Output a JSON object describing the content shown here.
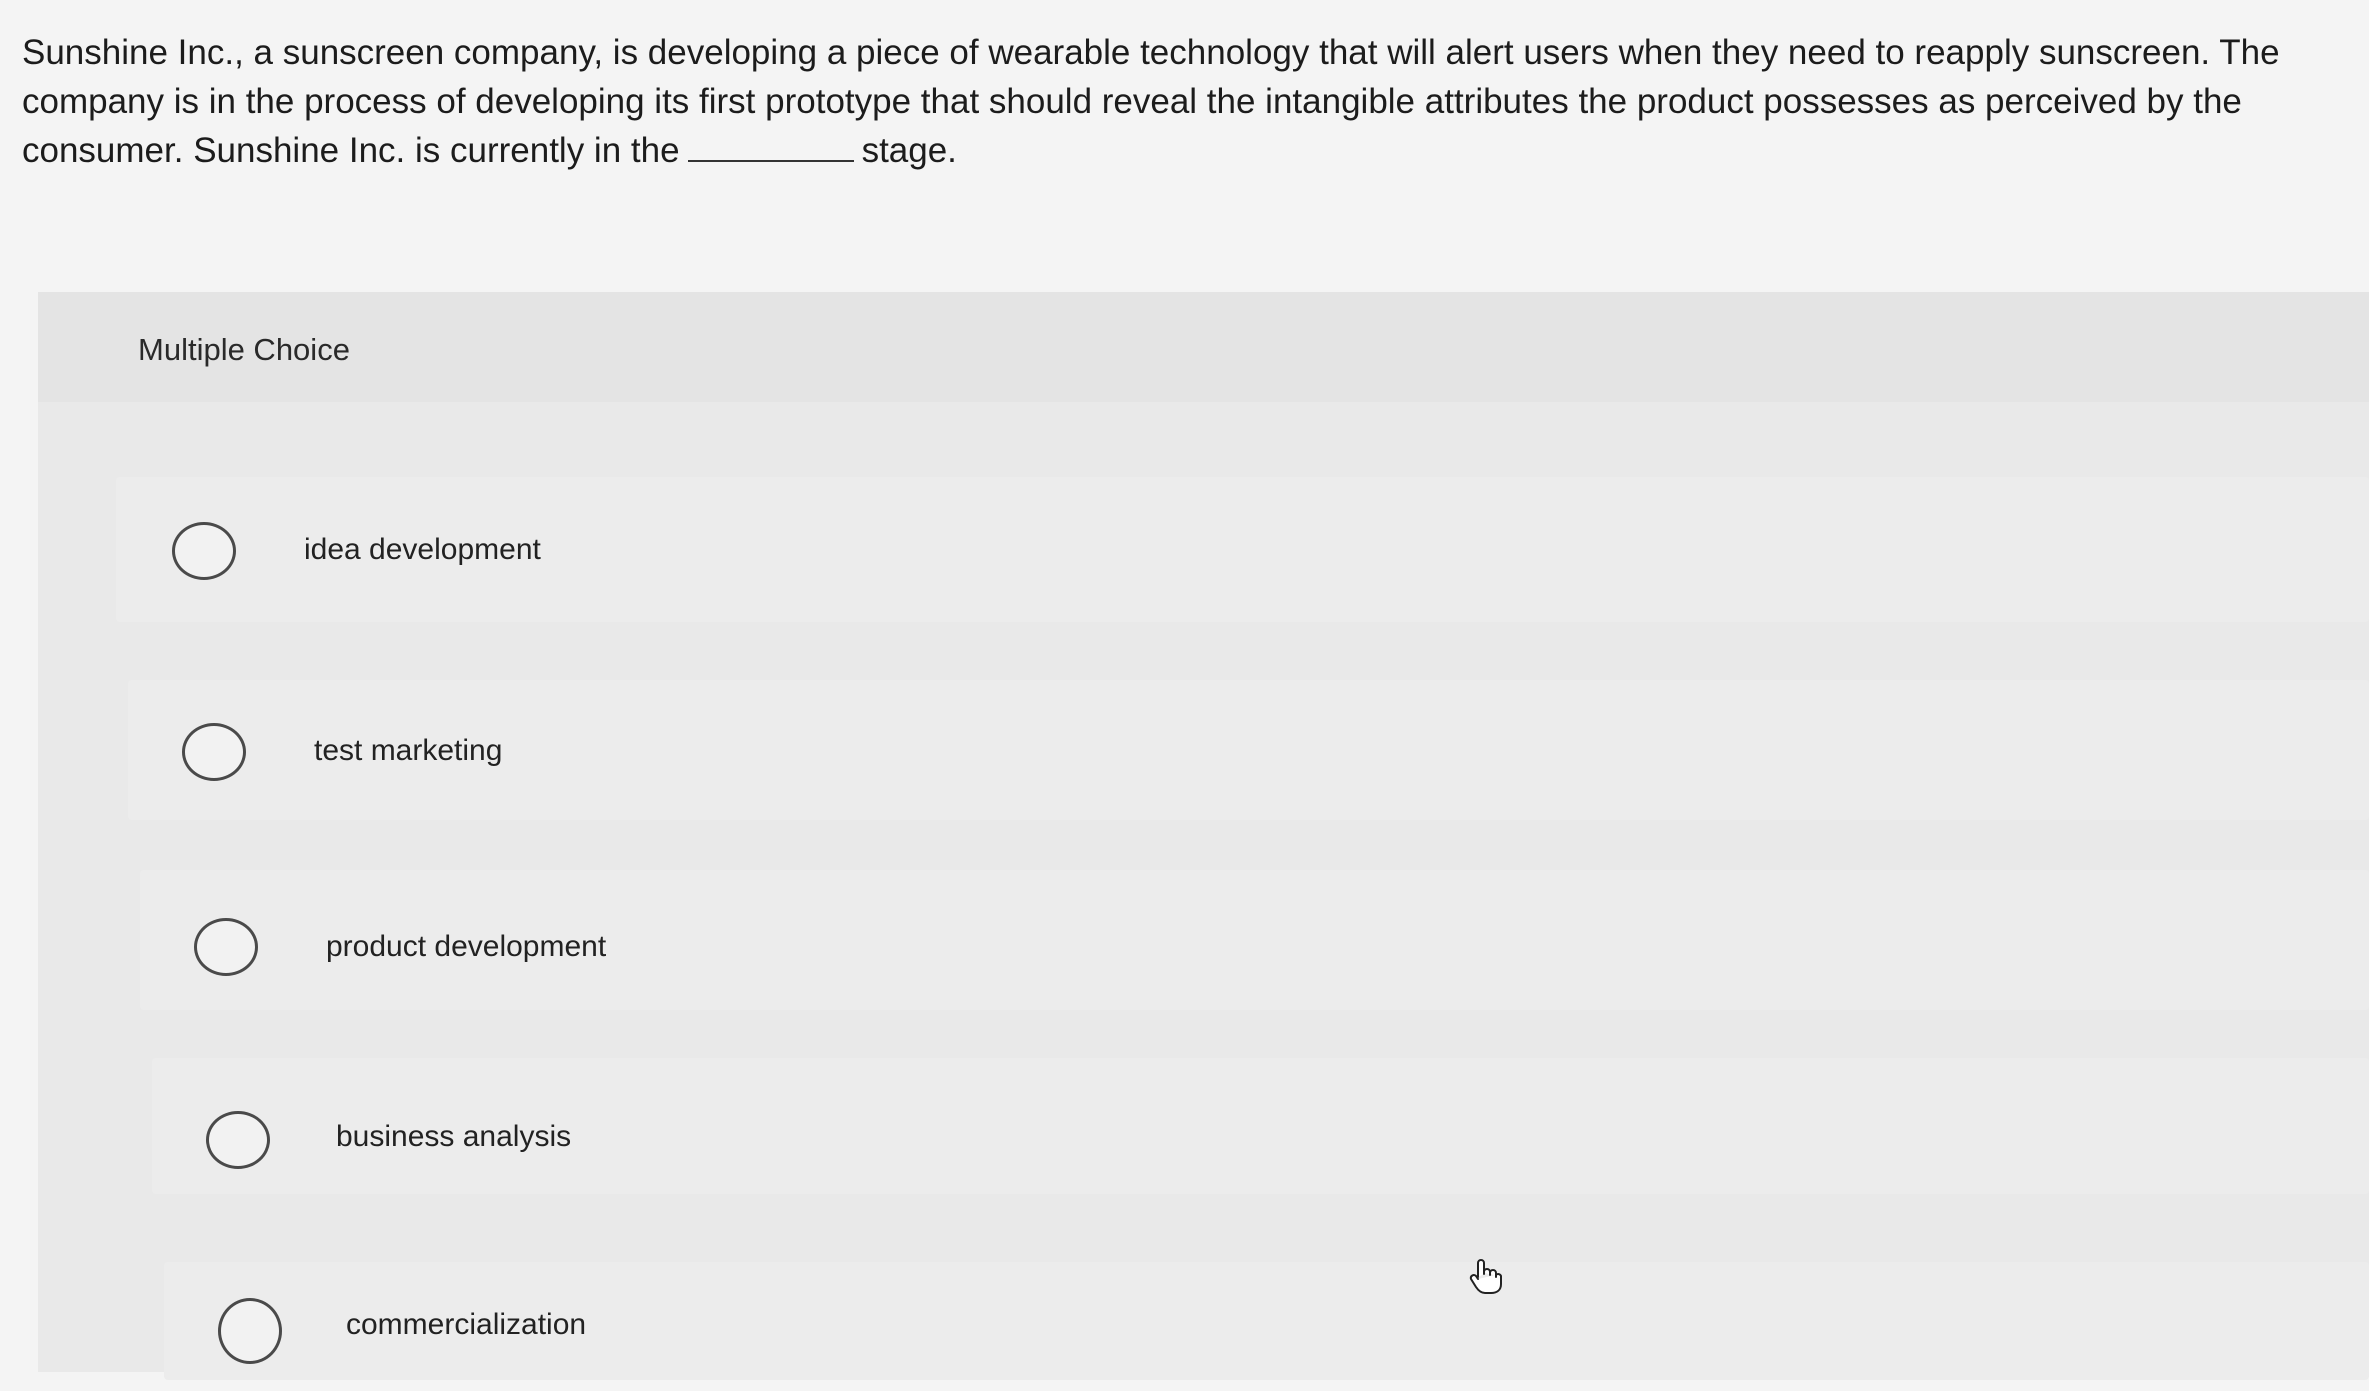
{
  "question": {
    "text_before": "Sunshine Inc., a sunscreen company, is developing a piece of wearable technology that will alert users when they need to reapply sunscreen. The company is in the process of developing its first prototype that should reveal the intangible attributes the product possesses as perceived by the consumer. Sunshine Inc. is currently in the",
    "text_after": "stage."
  },
  "panel": {
    "label": "Multiple Choice"
  },
  "options": [
    {
      "label": "idea development"
    },
    {
      "label": "test marketing"
    },
    {
      "label": "product development"
    },
    {
      "label": "business analysis"
    },
    {
      "label": "commercialization"
    }
  ],
  "icons": {
    "cursor": "hand-pointer-icon"
  }
}
